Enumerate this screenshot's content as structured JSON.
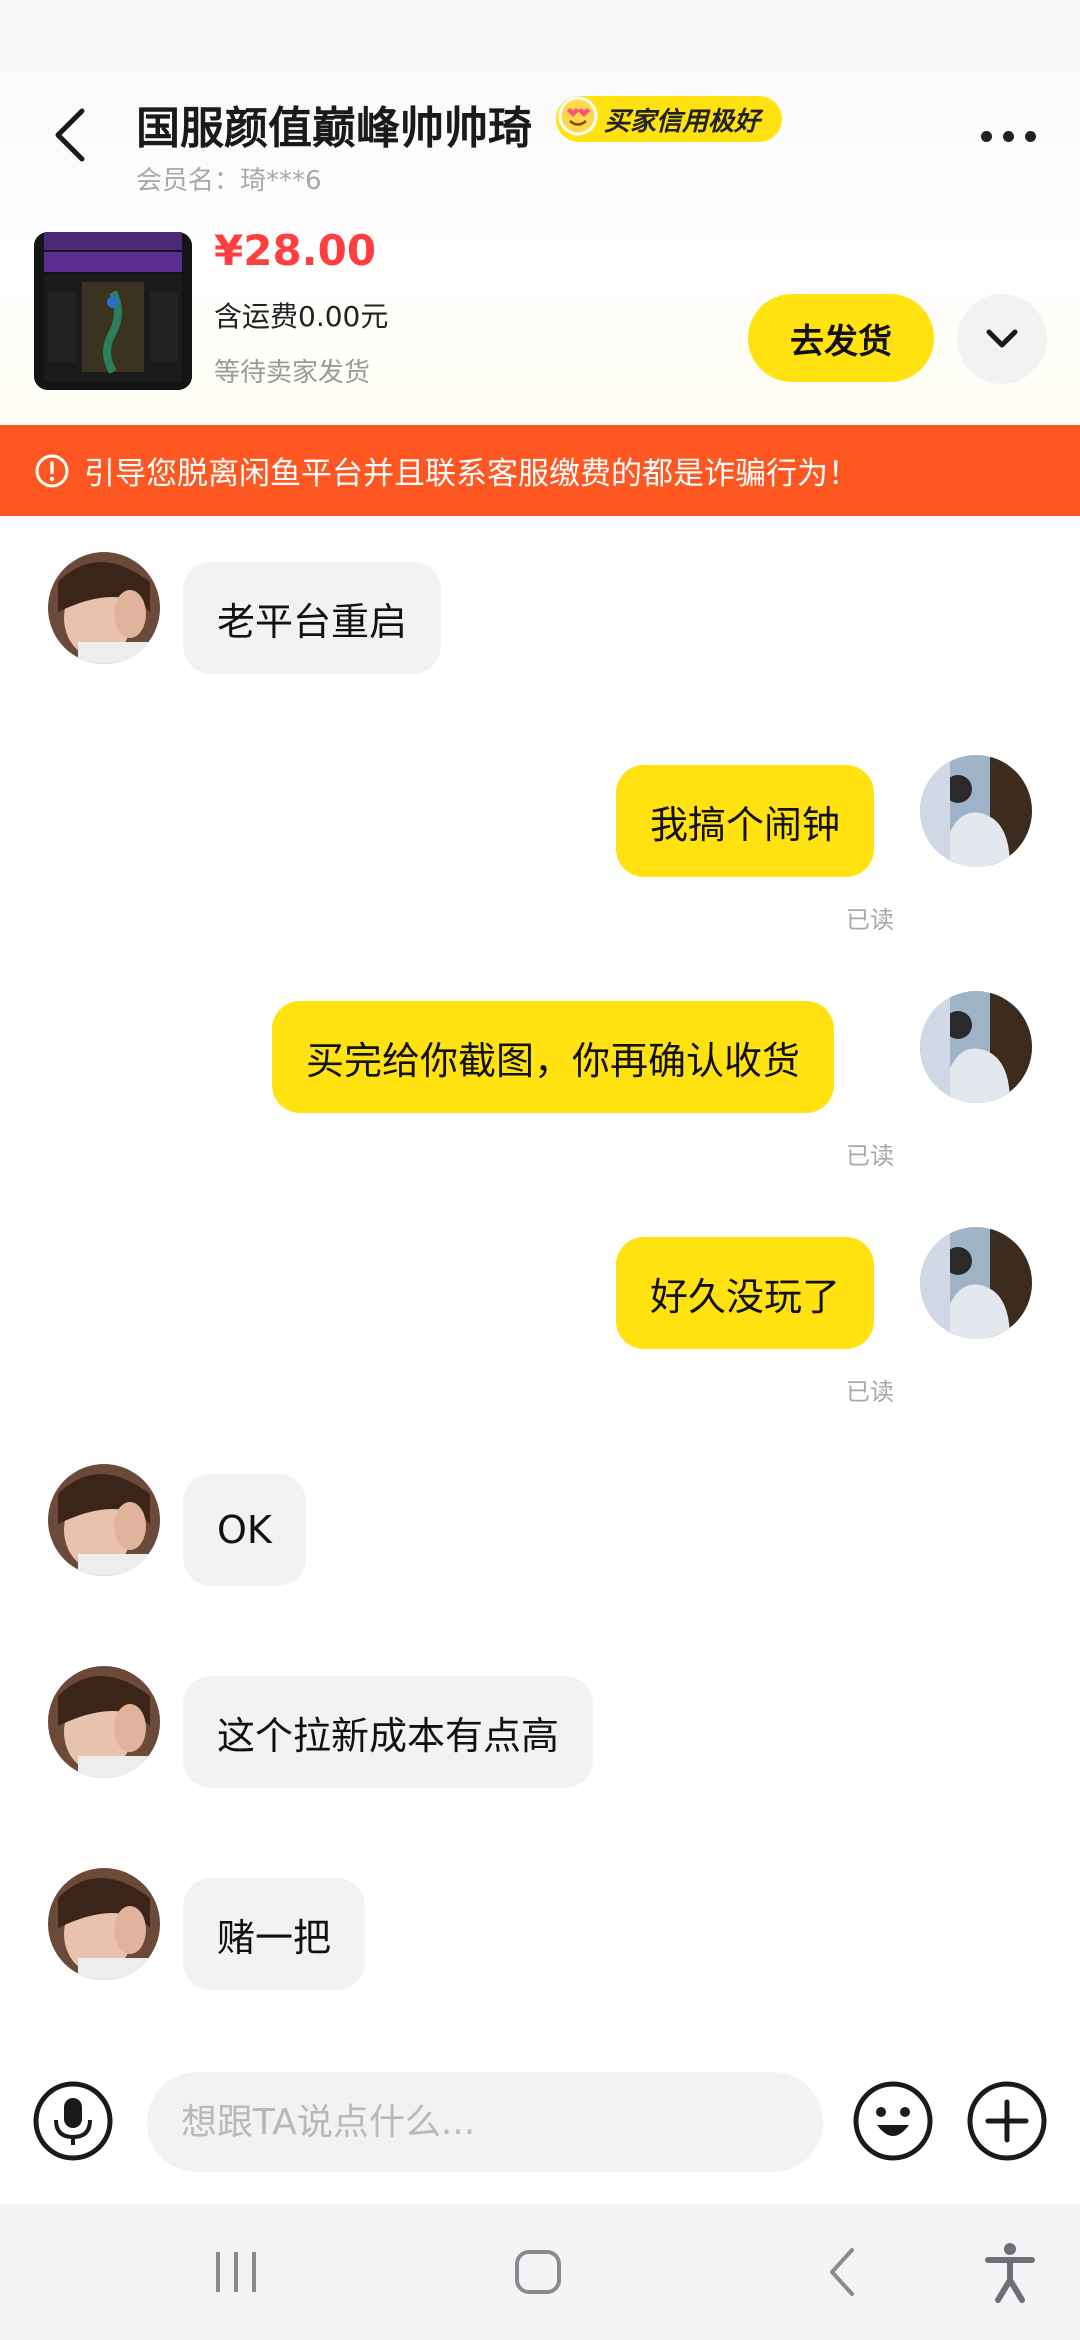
{
  "header": {
    "title": "国服颜值巅峰帅帅琦",
    "credit_badge": "买家信用极好",
    "member_name": "会员名：琦***6"
  },
  "order": {
    "price": "¥28.00",
    "shipping": "含运费0.00元",
    "status": "等待卖家发货",
    "ship_button": "去发货"
  },
  "warning": "引导您脱离闲鱼平台并且联系客服缴费的都是诈骗行为！",
  "messages": [
    {
      "from": "other",
      "text": "老平台重启"
    },
    {
      "from": "me",
      "text": "我搞个闹钟",
      "status": "已读"
    },
    {
      "from": "me",
      "text": "买完给你截图，你再确认收货",
      "status": "已读"
    },
    {
      "from": "me",
      "text": "好久没玩了",
      "status": "已读"
    },
    {
      "from": "other",
      "text": "OK"
    },
    {
      "from": "other",
      "text": "这个拉新成本有点高"
    },
    {
      "from": "other",
      "text": "赌一把"
    }
  ],
  "input": {
    "placeholder": "想跟TA说点什么..."
  },
  "colors": {
    "accent_yellow": "#ffe20f",
    "warning_orange": "#ff5722",
    "price_red": "#ff3f3f"
  },
  "icons": [
    "back-icon",
    "more-icon",
    "chevron-down-icon",
    "warning-icon",
    "mic-icon",
    "emoji-icon",
    "plus-icon",
    "recent-apps-icon",
    "home-icon",
    "nav-back-icon",
    "accessibility-icon"
  ]
}
